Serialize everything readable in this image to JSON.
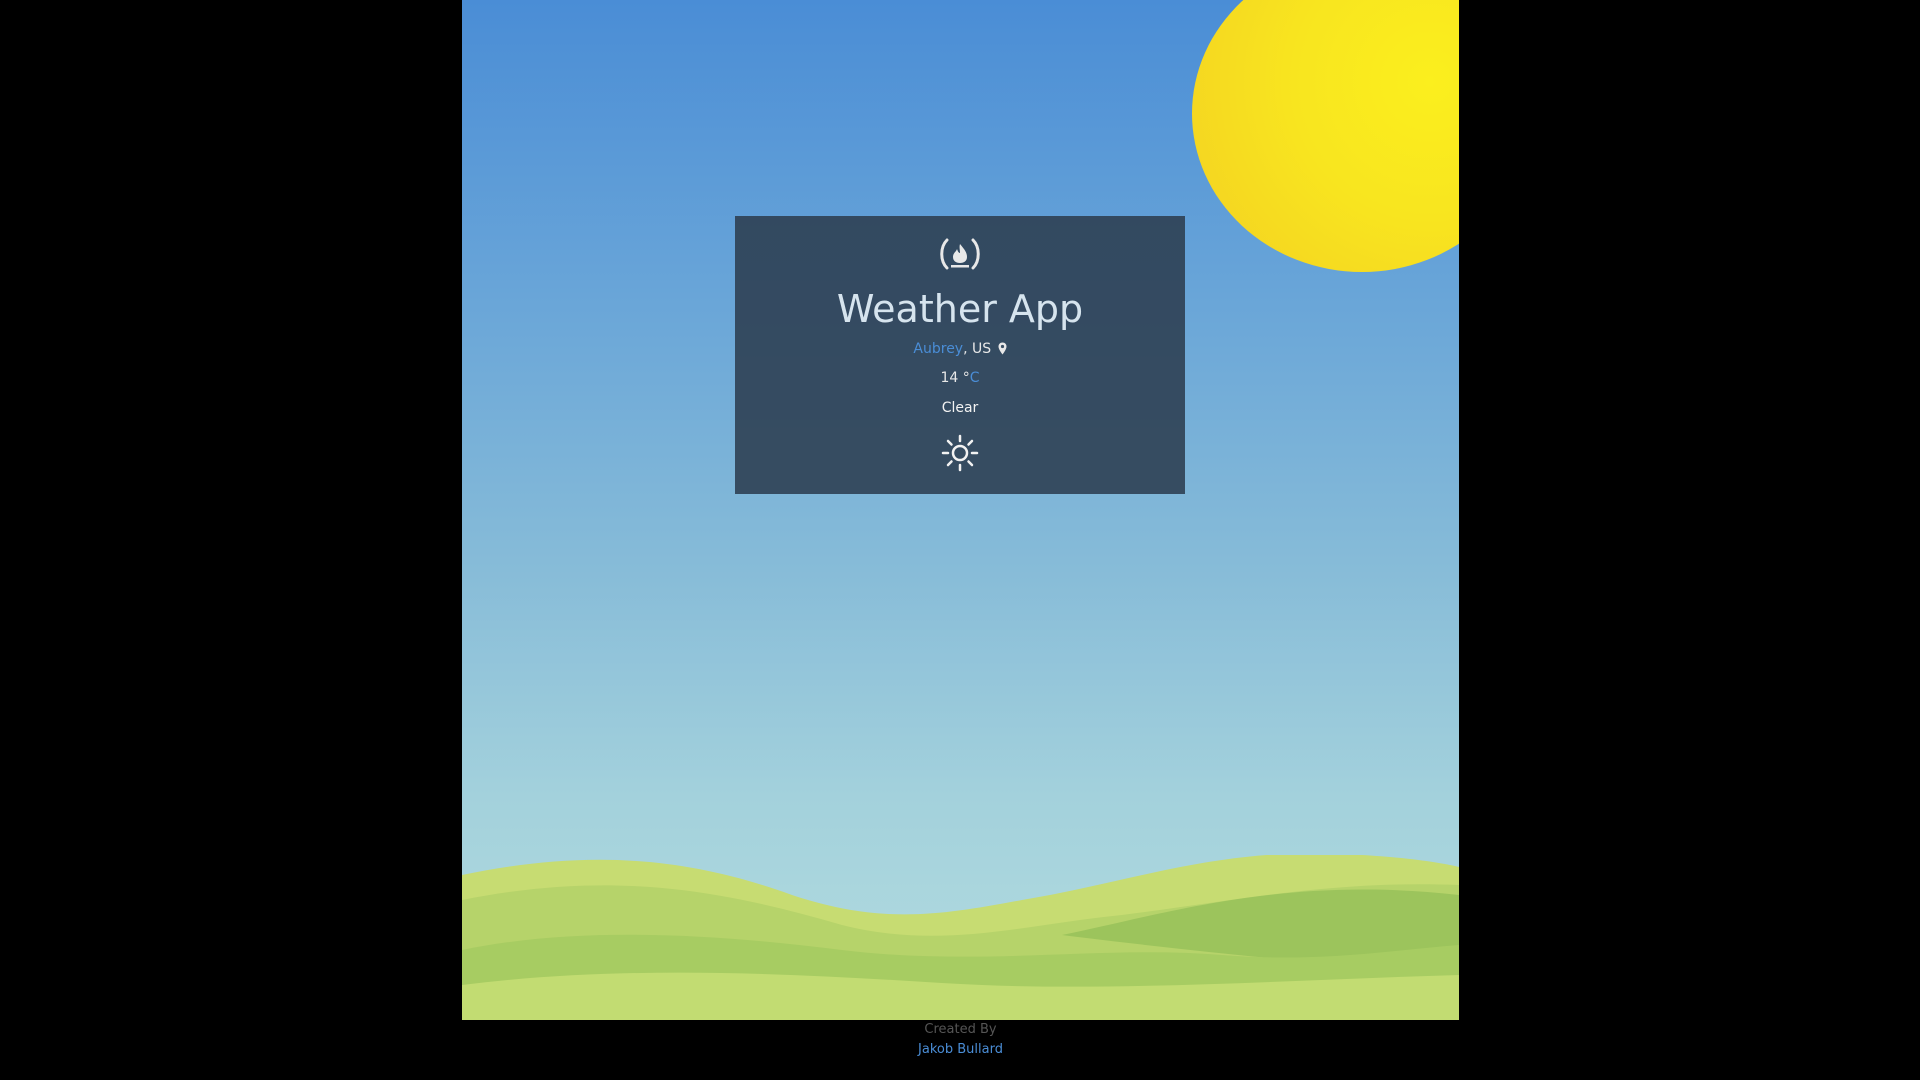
{
  "app": {
    "title": "Weather App"
  },
  "location": {
    "city": "Aubrey",
    "separator": ", ",
    "country": "US"
  },
  "weather": {
    "temperature": "14",
    "degree_symbol": " °",
    "unit": "C",
    "description": "Clear",
    "icon": "sun-icon"
  },
  "footer": {
    "created_by_label": "Created By",
    "author": "Jakob Bullard"
  },
  "colors": {
    "accent": "#4a8dd6",
    "card_background": "#2c3e50",
    "sun": "#f8e51f",
    "page_background": "#000000"
  }
}
